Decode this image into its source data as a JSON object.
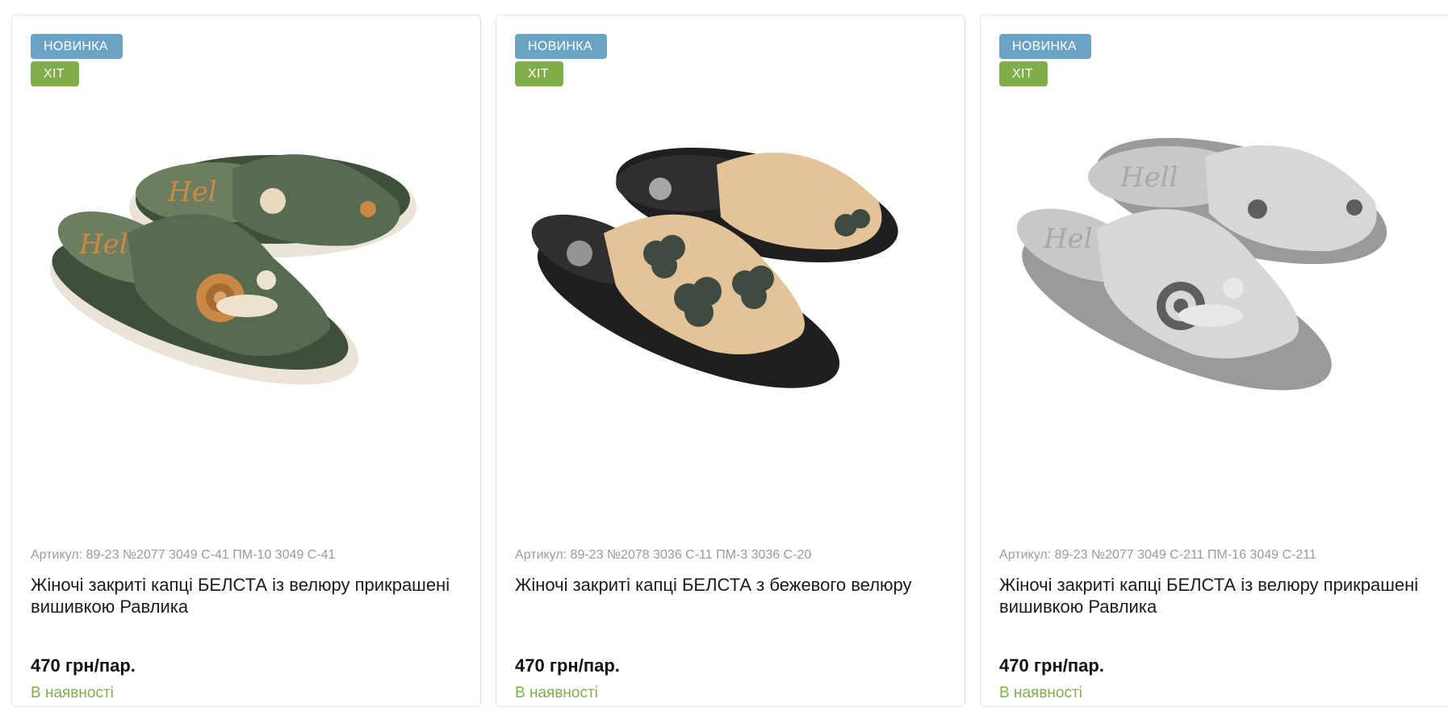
{
  "products": [
    {
      "badges": [
        "НОВИНКА",
        "ХІТ"
      ],
      "sku": "Артикул: 89-23 №2077 3049 С-41 ПМ-10 3049 С-41",
      "name": "Жіночі закриті капці БЕЛСТА із велюру прикрашені вишивкою Равлика",
      "price": "470 грн/пар.",
      "stock": "В наявності",
      "image_colors": {
        "upper": "#566b4f",
        "sole": "#3f4f3a",
        "accent": "#c98a45",
        "base": "#e9e3d8"
      }
    },
    {
      "badges": [
        "НОВИНКА",
        "ХІТ"
      ],
      "sku": "Артикул: 89-23 №2078 3036 С-11 ПМ-3 3036 С-20",
      "name": "Жіночі закриті капці БЕЛСТА з бежевого велюру",
      "price": "470 грн/пар.",
      "stock": "В наявності",
      "image_colors": {
        "upper": "#e5c398",
        "sole": "#2f2f2f",
        "accent": "#3f4a40",
        "base": "#1f1f1f"
      }
    },
    {
      "badges": [
        "НОВИНКА",
        "ХІТ"
      ],
      "sku": "Артикул: 89-23 №2077 3049 С-211 ПМ-16 3049 С-211",
      "name": "Жіночі закриті капці БЕЛСТА із велюру прикрашені вишивкою Равлика",
      "price": "470 грн/пар.",
      "stock": "В наявності",
      "image_colors": {
        "upper": "#d7d7d7",
        "sole": "#bdbdbd",
        "accent": "#5e5e5e",
        "base": "#9a9a9a"
      }
    }
  ],
  "colors": {
    "badge_new": "#6aa3c4",
    "badge_hit": "#7fae4a",
    "in_stock": "#7fae4a",
    "sku_text": "#9a9a9a"
  }
}
